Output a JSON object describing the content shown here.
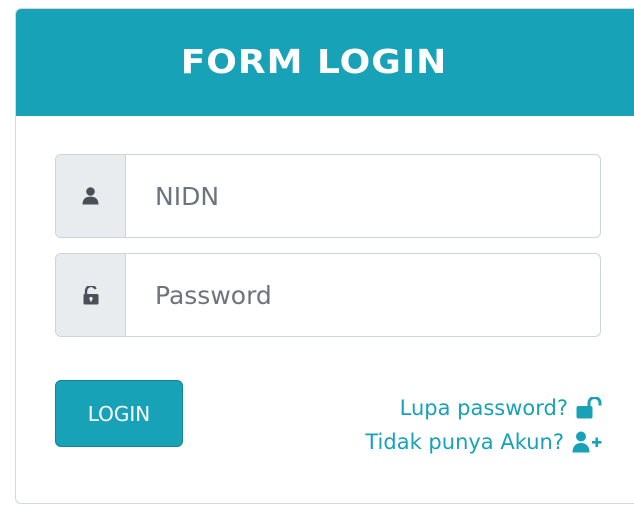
{
  "form": {
    "title": "FORM LOGIN",
    "nidn_placeholder": "NIDN",
    "password_placeholder": "Password",
    "login_label": "LOGIN",
    "forgot_password_label": "Lupa password?",
    "register_label": "Tidak punya Akun?"
  },
  "icons": {
    "nidn_field": "user-icon",
    "password_field": "unlock-icon",
    "forgot_password": "unlock-icon",
    "register": "user-plus-icon"
  },
  "colors": {
    "accent": "#17a2b8",
    "addon_background": "#e9ecef",
    "icon_dark": "#495057"
  }
}
